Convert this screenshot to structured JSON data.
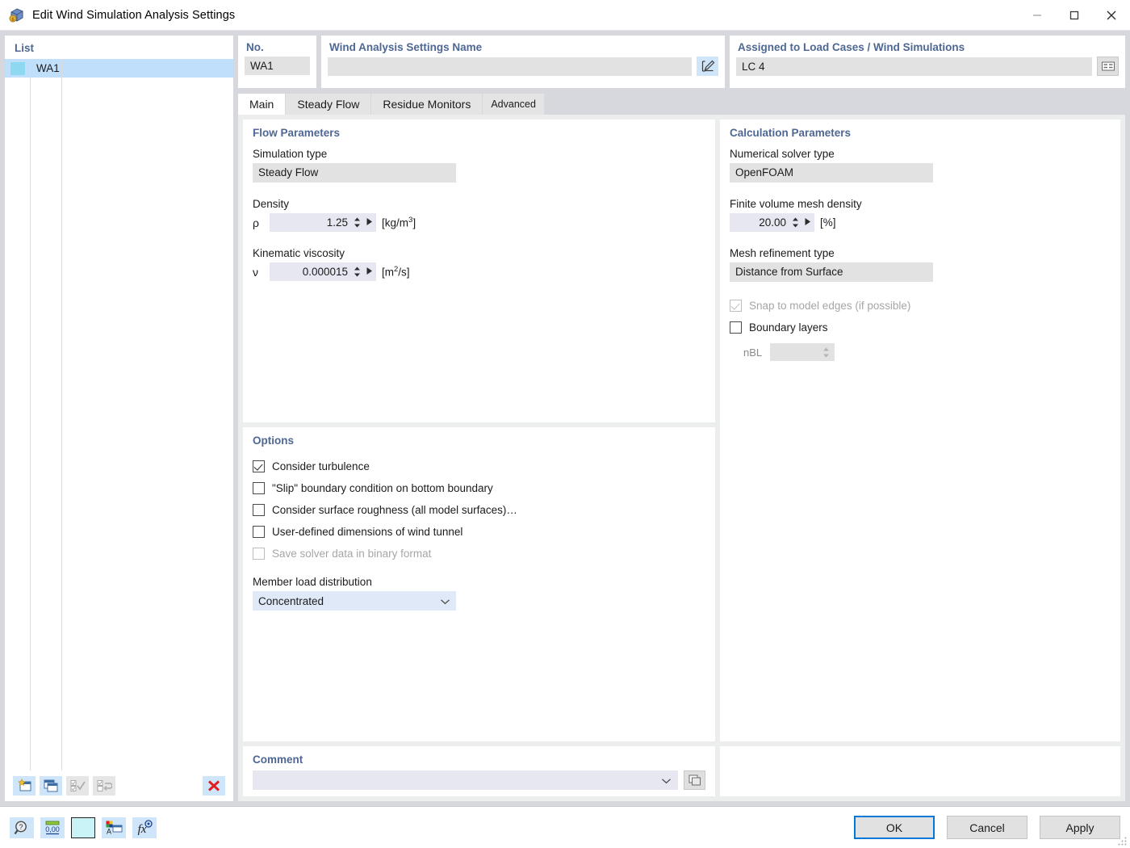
{
  "window": {
    "title": "Edit Wind Simulation Analysis Settings",
    "icon": "wind-simulation-icon",
    "minimize_label": "—",
    "maximize_label": "□",
    "close_label": "✕"
  },
  "list_panel": {
    "title": "List",
    "rows": [
      {
        "color": "#8fd8f2",
        "no": "WA1"
      }
    ],
    "toolbar": [
      {
        "name": "new-entry-button",
        "icon": "new-window-star-icon",
        "enabled": true
      },
      {
        "name": "copy-entry-button",
        "icon": "copy-windows-icon",
        "enabled": true
      },
      {
        "name": "select-all-button",
        "icon": "check-all-icon",
        "enabled": false
      },
      {
        "name": "invert-selection-button",
        "icon": "invert-check-icon",
        "enabled": false
      },
      {
        "name": "delete-entry-button",
        "icon": "red-x-icon",
        "enabled": true
      }
    ]
  },
  "header": {
    "no_label": "No.",
    "no_value": "WA1",
    "name_label": "Wind Analysis Settings Name",
    "name_value": "",
    "name_button_icon": "edit-pencil-icon",
    "assigned_label": "Assigned to Load Cases / Wind Simulations",
    "assigned_value": "LC 4",
    "assigned_button_icon": "list-select-icon"
  },
  "tabs": [
    {
      "label": "Main",
      "active": true,
      "small": false
    },
    {
      "label": "Steady Flow",
      "active": false,
      "small": false
    },
    {
      "label": "Residue Monitors",
      "active": false,
      "small": false
    },
    {
      "label": "Advanced",
      "active": false,
      "small": true
    }
  ],
  "flow_parameters": {
    "title": "Flow Parameters",
    "simulation_type_label": "Simulation type",
    "simulation_type_value": "Steady Flow",
    "density_label": "Density",
    "density_symbol": "ρ",
    "density_value": "1.25",
    "density_unit_pre": "[kg/m",
    "density_unit_sup": "3",
    "density_unit_post": "]",
    "viscosity_label": "Kinematic viscosity",
    "viscosity_symbol": "ν",
    "viscosity_value": "0.000015",
    "viscosity_unit_pre": "[m",
    "viscosity_unit_sup": "2",
    "viscosity_unit_post": "/s]"
  },
  "calculation_parameters": {
    "title": "Calculation Parameters",
    "solver_label": "Numerical solver type",
    "solver_value": "OpenFOAM",
    "mesh_density_label": "Finite volume mesh density",
    "mesh_density_value": "20.00",
    "mesh_density_unit": "[%]",
    "refinement_label": "Mesh refinement type",
    "refinement_value": "Distance from Surface",
    "snap_label": "Snap to model edges (if possible)",
    "snap_checked": true,
    "snap_enabled": false,
    "boundary_layers_label": "Boundary layers",
    "boundary_layers_checked": false,
    "nbl_label": "nBL",
    "nbl_value": ""
  },
  "options": {
    "title": "Options",
    "items": [
      {
        "label": "Consider turbulence",
        "checked": true,
        "enabled": true
      },
      {
        "label": "\"Slip\" boundary condition on bottom boundary",
        "checked": false,
        "enabled": true
      },
      {
        "label": "Consider surface roughness (all model surfaces)…",
        "checked": false,
        "enabled": true
      },
      {
        "label": "User-defined dimensions of wind tunnel",
        "checked": false,
        "enabled": true
      },
      {
        "label": "Save solver data in binary format",
        "checked": false,
        "enabled": false
      }
    ],
    "member_load_label": "Member load distribution",
    "member_load_value": "Concentrated"
  },
  "comment": {
    "title": "Comment",
    "value": "",
    "button_icon": "copy-comment-icon"
  },
  "footer": {
    "status_icons": [
      {
        "name": "help-info-button",
        "icon": "question-magnifier-icon"
      },
      {
        "name": "decimal-places-button",
        "icon": "number-format-icon"
      },
      {
        "name": "color-swatch-button",
        "icon": "color-swatch-icon"
      },
      {
        "name": "display-properties-button",
        "icon": "display-properties-icon"
      },
      {
        "name": "formula-button",
        "icon": "fx-formula-icon"
      }
    ],
    "buttons": [
      {
        "label": "OK",
        "primary": true
      },
      {
        "label": "Cancel",
        "primary": false
      },
      {
        "label": "Apply",
        "primary": false
      }
    ]
  },
  "colors": {
    "accent_blue": "#0078d7",
    "group_title": "#4e6793",
    "selection": "#bfdffa",
    "readonly_field": "#e2e2e2",
    "spin_field": "#e6e7f1",
    "combo_field": "#dfe9f7",
    "dialog_bg": "#d6d8dd"
  }
}
